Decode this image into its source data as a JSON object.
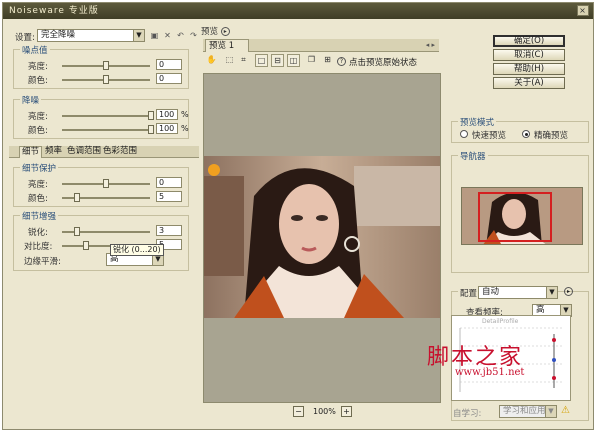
{
  "window": {
    "title": "Noiseware 专业版",
    "close": "×"
  },
  "left": {
    "setting_label": "设置:",
    "setting_value": "完全降噪",
    "toolbar_icons": [
      "save-icon",
      "delete-icon",
      "undo-icon",
      "redo-icon"
    ],
    "threshold": {
      "title": "噪点值",
      "rows": [
        {
          "label": "亮度:",
          "value": "0",
          "level": 0.5
        },
        {
          "label": "颜色:",
          "value": "0",
          "level": 0.5
        }
      ]
    },
    "denoise": {
      "title": "降噪",
      "rows": [
        {
          "label": "亮度:",
          "value": "100",
          "unit": "%",
          "level": 1.0
        },
        {
          "label": "颜色:",
          "value": "100",
          "unit": "%",
          "level": 1.0
        }
      ]
    },
    "tabs": [
      "细节",
      "频率",
      "色调范围",
      "色彩范围"
    ],
    "detail_protect": {
      "title": "细节保护",
      "rows": [
        {
          "label": "亮度:",
          "value": "0",
          "level": 0.5
        },
        {
          "label": "颜色:",
          "value": "5",
          "level": 0.15
        }
      ]
    },
    "detail_enhance": {
      "title": "细节增强",
      "rows": [
        {
          "label": "锐化:",
          "value": "3",
          "level": 0.15
        },
        {
          "label": "对比度:",
          "value": "5",
          "level": 0.25
        }
      ],
      "edge_label": "边缘平滑:",
      "edge_value": "高",
      "tooltip": "锐化 (0...20)"
    }
  },
  "preview": {
    "header": "预览",
    "header_icon": "▸",
    "tab": "预览 1",
    "nav_arrows": "◂ ▸",
    "tools": [
      "hand-icon",
      "select-icon",
      "crop-icon",
      "single-view-icon",
      "split-horizontal-icon",
      "split-vertical-icon",
      "copy-icon",
      "save-preview-icon",
      "help-icon"
    ],
    "hint": "点击预览原始状态",
    "zoom_minus": "−",
    "zoom": "100%",
    "zoom_plus": "+"
  },
  "right": {
    "buttons": [
      "确定(O)",
      "取消(C)",
      "帮助(H)",
      "关于(A)"
    ],
    "mode_title": "预览模式",
    "mode_fast": "快速预览",
    "mode_accurate": "精确预览",
    "mode_selected": "accurate",
    "navigator_title": "导航器",
    "config_label": "配置:",
    "config_value": "自动",
    "freq_label": "查看频率:",
    "freq_value": "高",
    "learn_label": "自学习:",
    "learn_value": "学习和应用",
    "freq_header": "DetailProfile"
  },
  "watermark": {
    "main": "脚本之家",
    "url": "www.jb51.net"
  },
  "colors": {
    "frame_red": "#d42020",
    "accent_blue": "#2a4f7a",
    "panel": "#ece7d0"
  }
}
